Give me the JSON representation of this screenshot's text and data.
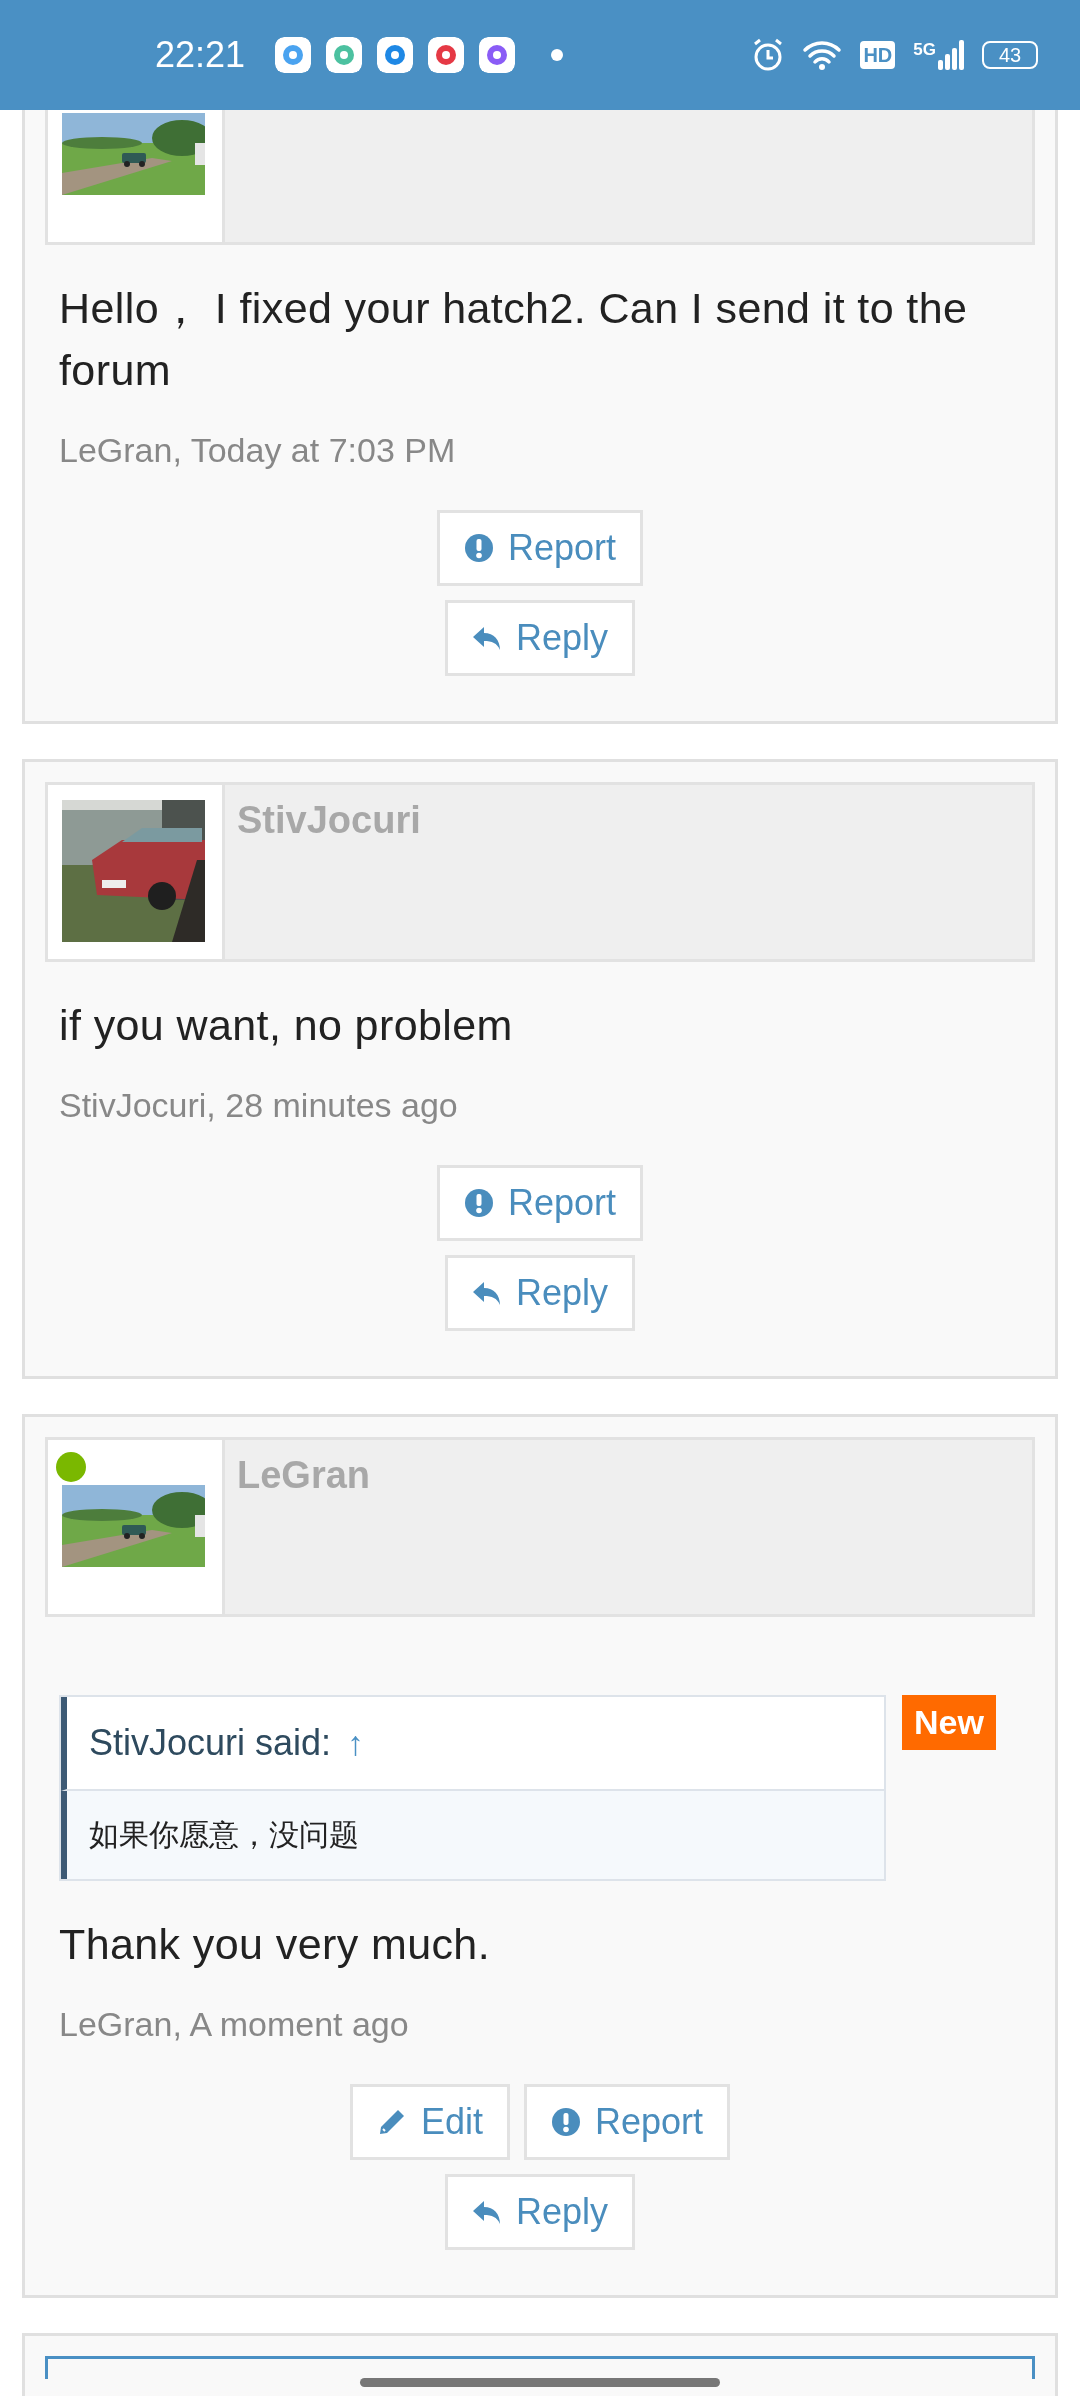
{
  "status_bar": {
    "time": "22:21",
    "network": "5G",
    "hd": "HD",
    "battery": "43"
  },
  "posts": [
    {
      "online": false,
      "message": "Hello， I fixed your hatch2. Can I send it to the forum",
      "meta": "LeGran, Today at 7:03 PM",
      "button_rows": [
        [
          {
            "kind": "report",
            "label": "Report"
          }
        ],
        [
          {
            "kind": "reply",
            "label": "Reply"
          }
        ]
      ]
    },
    {
      "author": "StivJocuri",
      "online": false,
      "message": "if you want, no problem",
      "meta": "StivJocuri, 28 minutes ago",
      "button_rows": [
        [
          {
            "kind": "report",
            "label": "Report"
          }
        ],
        [
          {
            "kind": "reply",
            "label": "Reply"
          }
        ]
      ]
    },
    {
      "author": "LeGran",
      "online": true,
      "badge": "New",
      "quote": {
        "author_line": "StivJocuri said:",
        "jump": "↑",
        "text": "如果你愿意，没问题"
      },
      "message": "Thank you very much.",
      "meta": "LeGran, A moment ago",
      "button_rows": [
        [
          {
            "kind": "edit",
            "label": "Edit"
          },
          {
            "kind": "report",
            "label": "Report"
          }
        ],
        [
          {
            "kind": "reply",
            "label": "Reply"
          }
        ]
      ]
    }
  ]
}
